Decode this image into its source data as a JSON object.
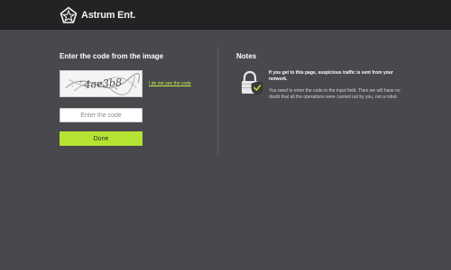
{
  "header": {
    "brand_name": "Astrum Ent."
  },
  "captcha_section": {
    "title": "Enter the code from the image",
    "captcha_image_text": "4ae3b8",
    "cant_see_link": "I do not see the code",
    "code_input_placeholder": "Enter the code",
    "code_input_value": "",
    "submit_label": "Done"
  },
  "notes_section": {
    "title": "Notes",
    "warning_text": "If you get to this page, suspicious traffic is sent from your network.",
    "body_text": "You need to enter the code in the input field. Then we will have no doubt that all the operations were carried out by you, not a robot."
  },
  "icons": {
    "logo": "astrum-star-logo-icon",
    "notes": "lock-shield-icon"
  },
  "colors": {
    "page_background": "#49494d",
    "header_background": "#232326",
    "accent": "#b5e334",
    "link": "#c8f04b"
  }
}
